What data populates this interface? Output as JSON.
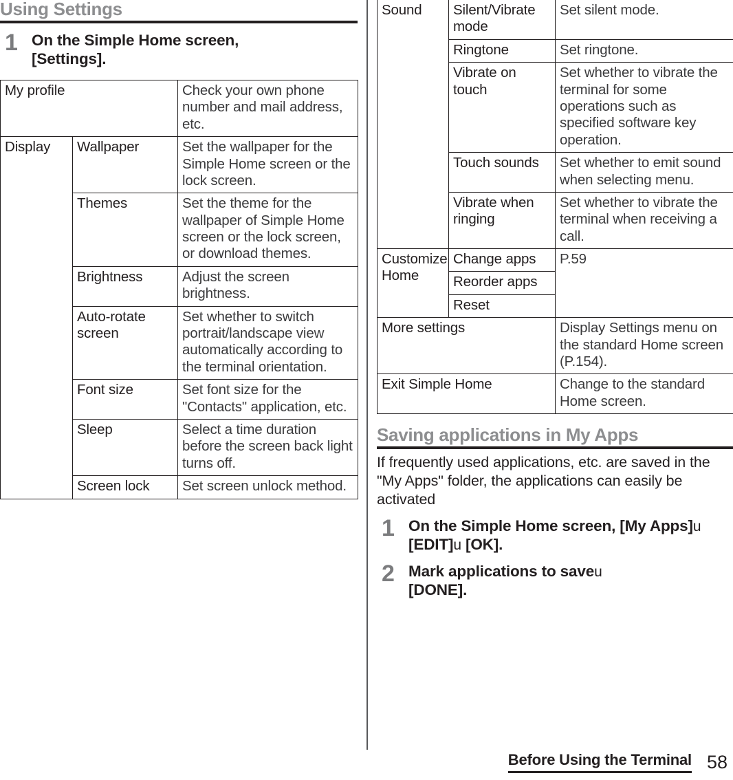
{
  "left": {
    "heading": "Using Settings",
    "step": {
      "number": "1",
      "text_before": "On the Simple Home screen, [Settings]."
    },
    "table": {
      "rows": [
        {
          "group": "My profile",
          "group_span": 2,
          "item": null,
          "desc": "Check your own phone number and mail address, etc.",
          "desc_rowspan": 1
        },
        {
          "group": "Display",
          "group_rowspan": 7,
          "item": "Wallpaper",
          "desc": "Set the wallpaper for the Simple Home screen or the lock screen."
        },
        {
          "item": "Themes",
          "desc": "Set the theme for the wallpaper of Simple Home screen or the lock screen, or download themes."
        },
        {
          "item": "Brightness",
          "desc": "Adjust the screen brightness."
        },
        {
          "item": "Auto-rotate screen",
          "desc": "Set whether to switch portrait/landscape view automatically according to the terminal orientation."
        },
        {
          "item": "Font size",
          "desc": "Set font size for the \"Contacts\" application, etc."
        },
        {
          "item": "Sleep",
          "desc": "Select a time duration before the screen back light turns off."
        },
        {
          "item": "Screen lock",
          "desc": "Set screen unlock method."
        }
      ]
    }
  },
  "right": {
    "table": {
      "rows": [
        {
          "group": "Sound",
          "group_rowspan": 5,
          "item": "Silent/Vibrate mode",
          "desc": "Set silent mode."
        },
        {
          "item": "Ringtone",
          "desc": "Set ringtone."
        },
        {
          "item": "Vibrate on touch",
          "desc": "Set whether to vibrate the terminal for some operations such as specified software key operation."
        },
        {
          "item": "Touch sounds",
          "desc": "Set whether to emit sound when selecting menu."
        },
        {
          "item": "Vibrate when ringing",
          "desc": "Set whether to vibrate the terminal when receiving a call."
        },
        {
          "group": "Customize Home",
          "group_rowspan": 3,
          "item": "Change apps",
          "desc": "P.59",
          "desc_rowspan": 3
        },
        {
          "item": "Reorder apps"
        },
        {
          "item": "Reset"
        },
        {
          "group": "More settings",
          "group_colspan": 2,
          "desc": "Display Settings menu on the standard Home screen (P.154)."
        },
        {
          "group": "Exit Simple Home",
          "group_colspan": 2,
          "desc": "Change to the standard Home screen."
        }
      ]
    },
    "heading": "Saving applications in My Apps",
    "intro": "If frequently used applications, etc. are saved in the \"My Apps\" folder, the applications can easily be activated",
    "steps": [
      {
        "number": "1",
        "parts": [
          {
            "t": "On the Simple Home screen, [My Apps]",
            "b": true
          },
          {
            "t": "u",
            "b": false
          },
          {
            "t": " [EDIT]",
            "b": true
          },
          {
            "t": "u",
            "b": false
          },
          {
            "t": " [OK].",
            "b": true
          }
        ]
      },
      {
        "number": "2",
        "parts": [
          {
            "t": "Mark applications to save",
            "b": true
          },
          {
            "t": "u",
            "b": false
          },
          {
            "t": " [DONE].",
            "b": true
          }
        ]
      }
    ]
  },
  "footer": {
    "title": "Before Using the Terminal",
    "page": "58"
  },
  "cells": {
    "l_r0_g": "My profile",
    "l_r0_d": "Check your own phone number and mail address, etc.",
    "l_r1_g": "Display",
    "l_r1_i": "Wallpaper",
    "l_r1_d": "Set the wallpaper for the Simple Home screen or the lock screen.",
    "l_r2_i": "Themes",
    "l_r2_d": "Set the theme for the wallpaper of Simple Home screen or the lock screen, or download themes.",
    "l_r3_i": "Brightness",
    "l_r3_d": "Adjust the screen brightness.",
    "l_r4_i": "Auto-rotate screen",
    "l_r4_d": "Set whether to switch portrait/landscape view automatically according to the terminal orientation.",
    "l_r5_i": "Font size",
    "l_r5_d": "Set font size for the \"Contacts\" application, etc.",
    "l_r6_i": "Sleep",
    "l_r6_d": "Select a time duration before the screen back light turns off.",
    "l_r7_i": "Screen lock",
    "l_r7_d": "Set screen unlock method.",
    "r_r0_g": "Sound",
    "r_r0_i": "Silent/Vibrate mode",
    "r_r0_d": "Set silent mode.",
    "r_r1_i": "Ringtone",
    "r_r1_d": "Set ringtone.",
    "r_r2_i": "Vibrate on touch",
    "r_r2_d": "Set whether to vibrate the terminal for some operations such as specified software key operation.",
    "r_r3_i": "Touch sounds",
    "r_r3_d": "Set whether to emit sound when selecting menu.",
    "r_r4_i": "Vibrate when ringing",
    "r_r4_d": "Set whether to vibrate the terminal when receiving a call.",
    "r_r5_g": "Customize Home",
    "r_r5_i": "Change apps",
    "r_r5_d": "P.59",
    "r_r6_i": "Reorder apps",
    "r_r7_i": "Reset",
    "r_r8_g": "More settings",
    "r_r8_d": "Display Settings menu on the standard Home screen (P.154).",
    "r_r9_g": "Exit Simple Home",
    "r_r9_d": "Change to the standard Home screen."
  },
  "steps_text": {
    "left_1_number": "1",
    "left_1_line1": "On the Simple Home screen,",
    "left_1_line2": "[Settings].",
    "right_1_number": "1",
    "right_1_a": "On the Simple Home screen, [My Apps]",
    "right_1_arrow1": "u",
    "right_1_b": " [EDIT]",
    "right_1_arrow2": "u",
    "right_1_c": " [OK].",
    "right_2_number": "2",
    "right_2_a": "Mark applications to save",
    "right_2_arrow1": "u",
    "right_2_b": " [DONE]."
  }
}
